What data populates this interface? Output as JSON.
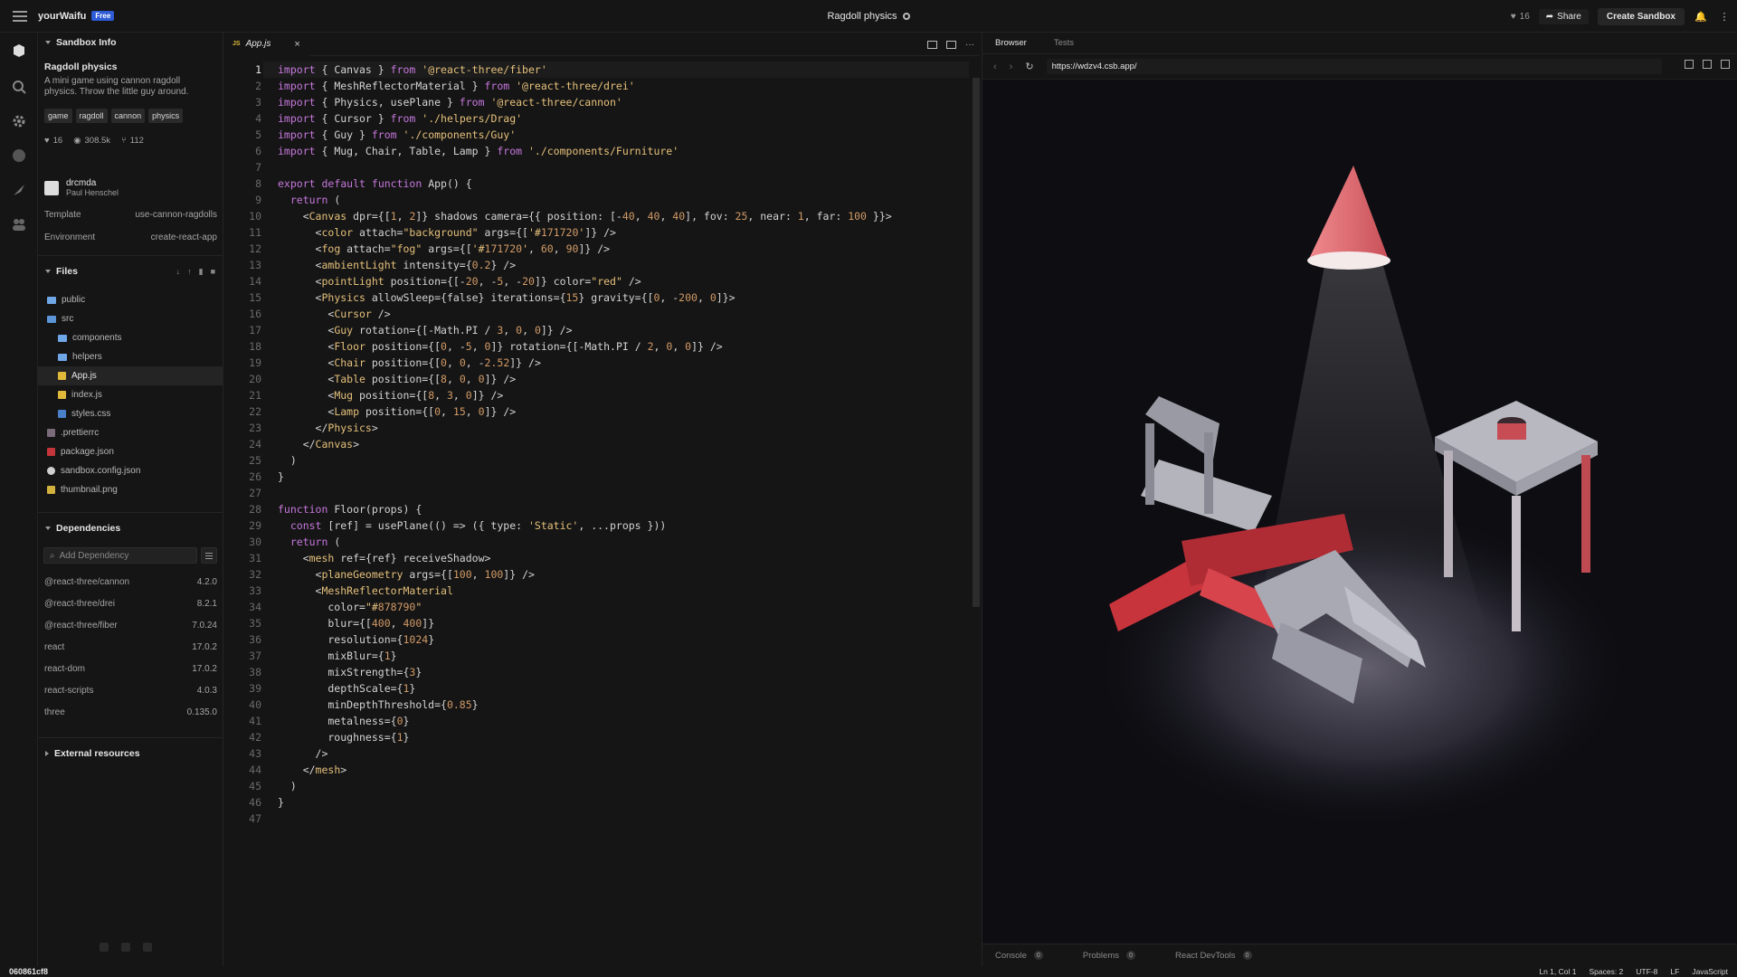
{
  "topbar": {
    "brand": "yourWaifu",
    "badge": "Free",
    "title": "Ragdoll physics",
    "likes": "16",
    "share_label": "Share",
    "create_label": "Create Sandbox"
  },
  "sidebar": {
    "section_title": "Sandbox Info",
    "project_title": "Ragdoll physics",
    "project_desc": "A mini game using cannon ragdoll physics. Throw the little guy around.",
    "tags": [
      "game",
      "ragdoll",
      "cannon",
      "physics"
    ],
    "stats": {
      "likes": "16",
      "views": "308.5k",
      "forks": "112"
    },
    "author": {
      "handle": "drcmda",
      "name": "Paul Henschel"
    },
    "template_label": "Template",
    "template_value": "use-cannon-ragdolls",
    "environment_label": "Environment",
    "environment_value": "create-react-app",
    "files_title": "Files",
    "files": [
      {
        "name": "public",
        "type": "folder",
        "depth": 0
      },
      {
        "name": "src",
        "type": "folder-open",
        "depth": 0
      },
      {
        "name": "components",
        "type": "folder",
        "depth": 1
      },
      {
        "name": "helpers",
        "type": "folder",
        "depth": 1
      },
      {
        "name": "App.js",
        "type": "js",
        "depth": 1,
        "active": true
      },
      {
        "name": "index.js",
        "type": "js",
        "depth": 1
      },
      {
        "name": "styles.css",
        "type": "css",
        "depth": 1
      },
      {
        "name": ".prettierrc",
        "type": "prettier",
        "depth": 0
      },
      {
        "name": "package.json",
        "type": "pkg",
        "depth": 0
      },
      {
        "name": "sandbox.config.json",
        "type": "cfg",
        "depth": 0
      },
      {
        "name": "thumbnail.png",
        "type": "png",
        "depth": 0
      }
    ],
    "deps_title": "Dependencies",
    "deps_placeholder": "Add Dependency",
    "dependencies": [
      {
        "name": "@react-three/cannon",
        "version": "4.2.0"
      },
      {
        "name": "@react-three/drei",
        "version": "8.2.1"
      },
      {
        "name": "@react-three/fiber",
        "version": "7.0.24"
      },
      {
        "name": "react",
        "version": "17.0.2"
      },
      {
        "name": "react-dom",
        "version": "17.0.2"
      },
      {
        "name": "react-scripts",
        "version": "4.0.3"
      },
      {
        "name": "three",
        "version": "0.135.0"
      }
    ],
    "external_title": "External resources"
  },
  "editor": {
    "tab_label": "App.js",
    "tab_badge": "JS",
    "current_line": 1,
    "lines": [
      "import { Canvas } from '@react-three/fiber'",
      "import { MeshReflectorMaterial } from '@react-three/drei'",
      "import { Physics, usePlane } from '@react-three/cannon'",
      "import { Cursor } from './helpers/Drag'",
      "import { Guy } from './components/Guy'",
      "import { Mug, Chair, Table, Lamp } from './components/Furniture'",
      "",
      "export default function App() {",
      "  return (",
      "    <Canvas dpr={[1, 2]} shadows camera={{ position: [-40, 40, 40], fov: 25, near: 1, far: 100 }}>",
      "      <color attach=\"background\" args={['#171720']} />",
      "      <fog attach=\"fog\" args={['#171720', 60, 90]} />",
      "      <ambientLight intensity={0.2} />",
      "      <pointLight position={[-20, -5, -20]} color=\"red\" />",
      "      <Physics allowSleep={false} iterations={15} gravity={[0, -200, 0]}>",
      "        <Cursor />",
      "        <Guy rotation={[-Math.PI / 3, 0, 0]} />",
      "        <Floor position={[0, -5, 0]} rotation={[-Math.PI / 2, 0, 0]} />",
      "        <Chair position={[0, 0, -2.52]} />",
      "        <Table position={[8, 0, 0]} />",
      "        <Mug position={[8, 3, 0]} />",
      "        <Lamp position={[0, 15, 0]} />",
      "      </Physics>",
      "    </Canvas>",
      "  )",
      "}",
      "",
      "function Floor(props) {",
      "  const [ref] = usePlane(() => ({ type: 'Static', ...props }))",
      "  return (",
      "    <mesh ref={ref} receiveShadow>",
      "      <planeGeometry args={[100, 100]} />",
      "      <MeshReflectorMaterial",
      "        color=\"#878790\"",
      "        blur={[400, 400]}",
      "        resolution={1024}",
      "        mixBlur={1}",
      "        mixStrength={3}",
      "        depthScale={1}",
      "        minDepthThreshold={0.85}",
      "        metalness={0}",
      "        roughness={1}",
      "      />",
      "    </mesh>",
      "  )",
      "}",
      ""
    ]
  },
  "browser": {
    "tab_browser": "Browser",
    "tab_tests": "Tests",
    "url": "https://wdzv4.csb.app/",
    "console_label": "Console",
    "console_count": "0",
    "problems_label": "Problems",
    "problems_count": "0",
    "devtools_label": "React DevTools",
    "devtools_count": "0"
  },
  "status": {
    "hash": "060861cf8",
    "position": "Ln 1, Col 1",
    "spaces": "Spaces: 2",
    "encoding": "UTF-8",
    "eol": "LF",
    "language": "JavaScript"
  },
  "colors": {
    "accent": "#2e5bd6",
    "background": "#151515",
    "scene_bg": "#0d0d12",
    "lamp": "#e87a80",
    "ragdoll_red": "#c8343c"
  }
}
